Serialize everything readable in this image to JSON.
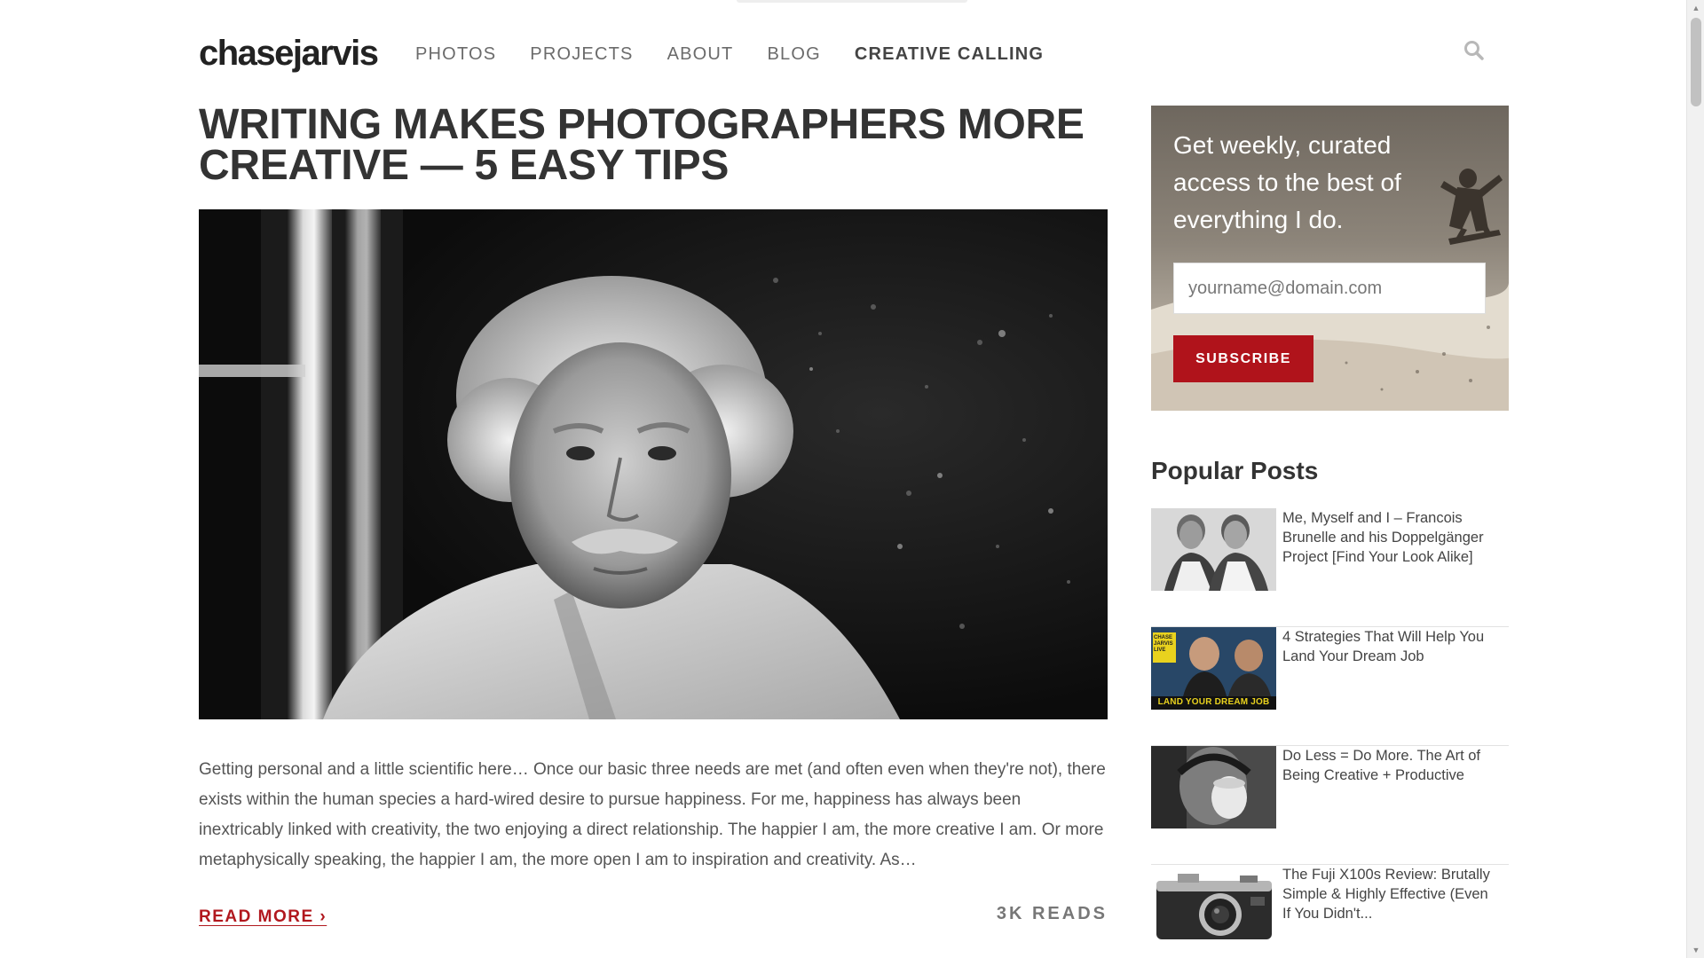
{
  "site": {
    "logo": "chasejarvis",
    "nav": [
      {
        "label": "PHOTOS"
      },
      {
        "label": "PROJECTS"
      },
      {
        "label": "ABOUT"
      },
      {
        "label": "BLOG"
      },
      {
        "label": "CREATIVE CALLING"
      }
    ],
    "search_icon": "search-icon"
  },
  "post": {
    "title": "WRITING MAKES PHOTOGRAPHERS MORE CREATIVE — 5 EASY TIPS",
    "excerpt": "Getting personal and a little scientific here… Once our basic three needs are met (and often even when they're not), there exists within the human species a hard-wired desire to pursue happiness. For me, happiness has always been inextricably linked with creativity, the two enjoying a direct relationship. The happier I am, the more creative I am. Or more metaphysically speaking, the happier I am, the more open I am to inspiration and creativity. As…",
    "read_more": "READ MORE ›",
    "reads": "3K READS"
  },
  "signup": {
    "text": "Get weekly, curated access to the best of everything I do.",
    "email_placeholder": "yourname@domain.com",
    "button": "SUBSCRIBE"
  },
  "popular": {
    "title": "Popular Posts",
    "items": [
      {
        "title": "Me, Myself and I – Francois Brunelle and his Doppelgänger Project [Find Your Look Alike]"
      },
      {
        "title": "4 Strategies That Will Help You Land Your Dream Job",
        "thumb_caption": "LAND YOUR DREAM JOB",
        "thumb_badge": "CHASE JARVIS LIVE"
      },
      {
        "title": "Do Less = Do More. The Art of Being Creative + Productive"
      },
      {
        "title": "The Fuji X100s Review: Brutally Simple & Highly Effective (Even If You Didn't..."
      }
    ]
  },
  "colors": {
    "accent_red": "#b1181e",
    "button_red": "#b0131b",
    "text": "#333333"
  }
}
